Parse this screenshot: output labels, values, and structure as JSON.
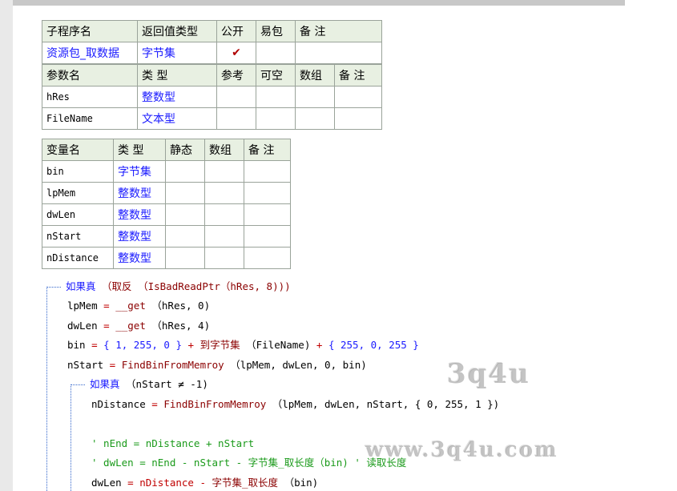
{
  "subroutine_table": {
    "headers": [
      "子程序名",
      "返回值类型",
      "公开",
      "易包",
      "备 注"
    ],
    "row": {
      "name": "资源包_取数据",
      "return_type": "字节集",
      "public_mark": "✔",
      "easy_pkg": "",
      "remark": ""
    }
  },
  "params_table": {
    "headers": [
      "参数名",
      "类 型",
      "参考",
      "可空",
      "数组",
      "备 注"
    ],
    "rows": [
      {
        "name": "hRes",
        "type": "整数型"
      },
      {
        "name": "FileName",
        "type": "文本型"
      }
    ]
  },
  "vars_table": {
    "headers": [
      "变量名",
      "类 型",
      "静态",
      "数组",
      "备 注"
    ],
    "rows": [
      {
        "name": "bin",
        "type": "字节集"
      },
      {
        "name": "lpMem",
        "type": "整数型"
      },
      {
        "name": "dwLen",
        "type": "整数型"
      },
      {
        "name": "nStart",
        "type": "整数型"
      },
      {
        "name": "nDistance",
        "type": "整数型"
      }
    ]
  },
  "code": {
    "l1_kw": "如果真",
    "l1_fn": "（取反",
    "l1_rest": "（IsBadReadPtr（hRes, 8)))",
    "l2_var": "lpMem",
    "l2_eq": " = ",
    "l2_fn": "__get",
    "l2_args": "（hRes, 0)",
    "l3_var": "dwLen",
    "l3_eq": " = ",
    "l3_fn": "__get",
    "l3_args": "（hRes, 4)",
    "l4_a": "bin",
    "l4_b": " = ",
    "l4_c": "{ 1, 255, 0 }",
    "l4_d": " + ",
    "l4_e": "到字节集",
    "l4_f": "（FileName)",
    "l4_g": " + ",
    "l4_h": "{ 255, 0, 255 }",
    "l5_var": "nStart",
    "l5_eq": " = ",
    "l5_fn": "FindBinFromMemroy",
    "l5_args": "（lpMem, dwLen, 0, bin)",
    "l6_kw": "如果真",
    "l6_rest": "（nStart ≠ -1)",
    "l7_var": "nDistance",
    "l7_eq": " = ",
    "l7_fn": "FindBinFromMemroy",
    "l7_args": "（lpMem, dwLen, nStart, { 0, 255, 1 })",
    "l8_comment": "' nEnd = nDistance + nStart",
    "l9_comment": "' dwLen = nEnd - nStart - 字节集_取长度（bin) ' 读取长度",
    "l10_var": "dwLen",
    "l10_eq": " = nDistance - ",
    "l10_fn": "字节集_取长度",
    "l10_args": "（bin)"
  },
  "watermark": {
    "text1": "3q4u",
    "text2": "www.3q4u.com"
  },
  "colors": {
    "keyword": "#1a1aff",
    "function": "#8b0000",
    "comment": "#1a9a1a",
    "header_bg": "#e8f0e2",
    "grid_border": "#9aa39a"
  }
}
